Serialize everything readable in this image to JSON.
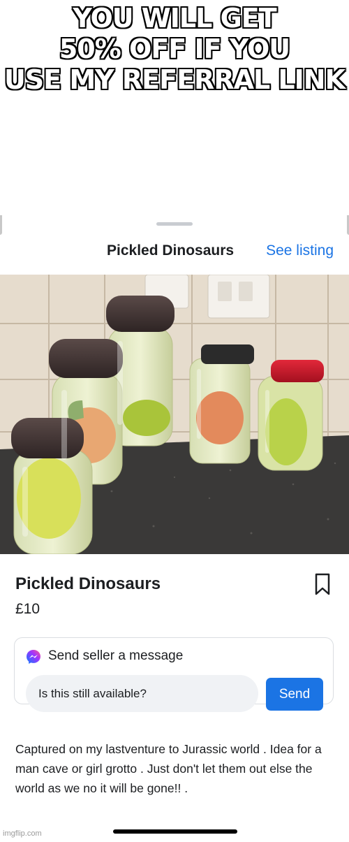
{
  "meme": {
    "caption_lines": [
      "YOU WILL GET",
      "50% OFF IF YOU",
      "USE MY REFERRAL LINK"
    ]
  },
  "sheet": {
    "title": "Pickled Dinosaurs",
    "see_listing_label": "See listing"
  },
  "listing": {
    "title": "Pickled Dinosaurs",
    "price": "£10",
    "description": "Captured on my lastventure to Jurassic world . Idea for a man cave or girl grotto . Just don't let them out else the world as we no it will be gone!! ."
  },
  "message": {
    "heading": "Send seller a message",
    "input_value": "Is this still available?",
    "send_label": "Send"
  },
  "watermark": "imgflip.com",
  "colors": {
    "accent": "#1b74e4",
    "text": "#1c1e21",
    "input_bg": "#f0f2f5"
  },
  "icons": [
    "messenger-icon",
    "bookmark-icon"
  ]
}
